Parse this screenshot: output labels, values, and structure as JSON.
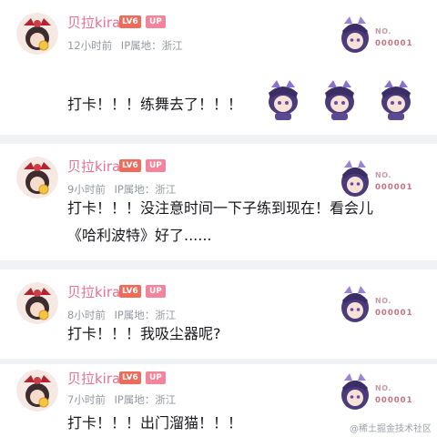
{
  "comments": [
    {
      "user": "贝拉kira",
      "level": "LV6",
      "up_badge": "UP",
      "time": "12小时前",
      "ip": "IP属地：浙江",
      "fan_label": "NO.",
      "fan_number": "000001",
      "lines": [
        "打卡！！！练舞去了！！！"
      ],
      "stickers": 3
    },
    {
      "user": "贝拉kira",
      "level": "LV6",
      "up_badge": "UP",
      "time": "9小时前",
      "ip": "IP属地：浙江",
      "fan_label": "NO.",
      "fan_number": "000001",
      "lines": [
        "打卡！！！没注意时间一下子练到现在！看会儿",
        "《哈利波特》好了......"
      ]
    },
    {
      "user": "贝拉kira",
      "level": "LV6",
      "up_badge": "UP",
      "time": "8小时前",
      "ip": "IP属地：浙江",
      "fan_label": "NO.",
      "fan_number": "000001",
      "lines": [
        "打卡！！！我吸尘器呢?"
      ]
    },
    {
      "user": "贝拉kira",
      "level": "LV6",
      "up_badge": "UP",
      "time": "7小时前",
      "ip": "IP属地：浙江",
      "fan_label": "NO.",
      "fan_number": "000001",
      "lines": [
        "打卡！！！出门溜猫！！！"
      ]
    }
  ],
  "watermark": "@稀土掘金技术社区",
  "colors": {
    "name": "#ea6f93",
    "level_badge": "#ee6b5b",
    "up_badge": "#f4839b",
    "meta": "#9499a0",
    "background": "#f1f2f4"
  }
}
